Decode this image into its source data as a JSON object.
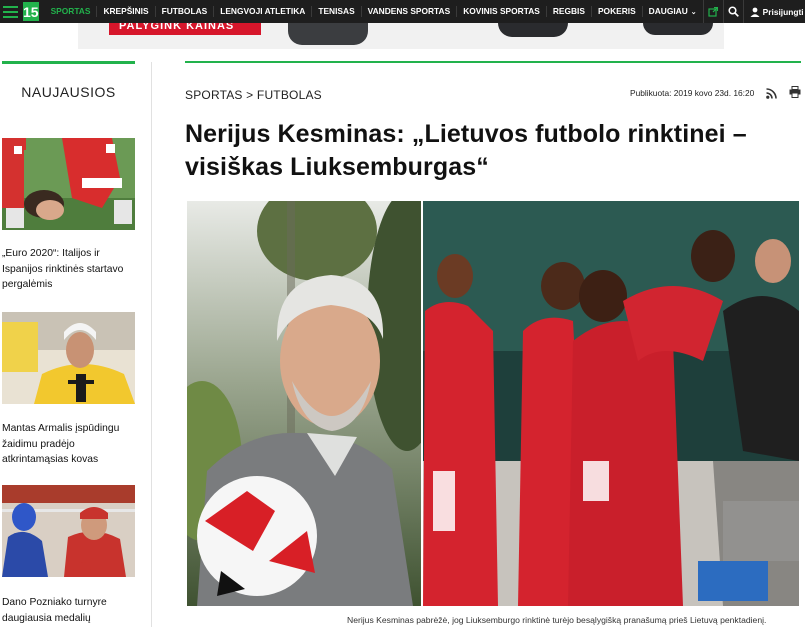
{
  "topbar": {
    "logo": "15",
    "nav": [
      "SPORTAS",
      "KREPŠINIS",
      "FUTBOLAS",
      "LENGVOJI ATLETIKA",
      "TENISAS",
      "VANDENS SPORTAS",
      "KOVINIS SPORTAS",
      "REGBIS",
      "POKERIS",
      "DAUGIAU"
    ],
    "login": "Prisijungti",
    "accent": "#22b24c"
  },
  "ad": {
    "text": "PALYGINK KAINAS"
  },
  "sidebar": {
    "title": "NAUJAUSIOS",
    "items": [
      {
        "caption": "„Euro 2020“: Italijos ir Ispanijos rinktinės startavo pergalėmis"
      },
      {
        "caption": "Mantas Armalis įspūdingu žaidimu pradėjo atkrintamąsias kovas"
      },
      {
        "caption": "Dano Pozniako turnyre daugiausia medalių"
      }
    ]
  },
  "article": {
    "breadcrumb": "SPORTAS > FUTBOLAS",
    "published": "Publikuota: 2019 kovo 23d. 16:20",
    "title": "Nerijus Kesminas: „Lietuvos futbolo rinktinei – visiškas Liuksemburgas“",
    "photo_caption": "Nerijus Kesminas pabrėžė, jog Liuksemburgo rinktinė turėjo besąlygišką pranašumą prieš Lietuvą penktadienį."
  }
}
